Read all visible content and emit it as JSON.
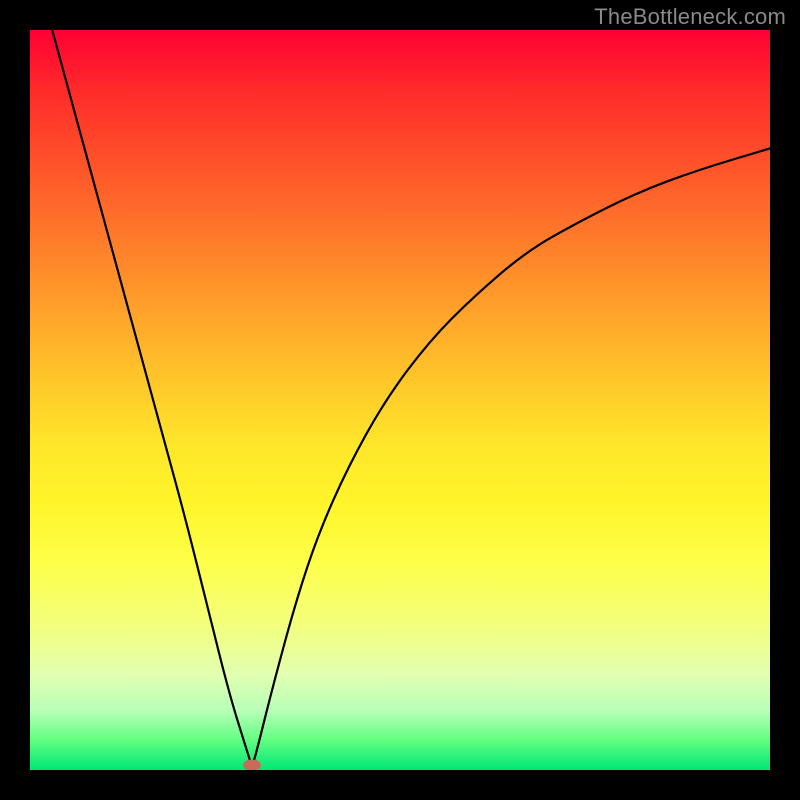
{
  "watermark": "TheBottleneck.com",
  "chart_data": {
    "type": "line",
    "title": "",
    "xlabel": "",
    "ylabel": "",
    "xlim": [
      0,
      1
    ],
    "ylim": [
      0,
      1
    ],
    "grid": false,
    "legend": false,
    "marker": {
      "x": 0.3,
      "y": 0.005,
      "color": "#c96b5a"
    },
    "series": [
      {
        "name": "bottleneck-curve",
        "descends_from_top_left_to_minimum_then_rises": true,
        "minimum_x": 0.3,
        "x": [
          0.03,
          0.06,
          0.09,
          0.12,
          0.15,
          0.18,
          0.21,
          0.24,
          0.27,
          0.295,
          0.3,
          0.305,
          0.33,
          0.36,
          0.39,
          0.43,
          0.48,
          0.54,
          0.6,
          0.67,
          0.74,
          0.82,
          0.9,
          1.0
        ],
        "y": [
          1.0,
          0.89,
          0.78,
          0.67,
          0.56,
          0.45,
          0.34,
          0.22,
          0.1,
          0.02,
          0.005,
          0.02,
          0.12,
          0.23,
          0.32,
          0.41,
          0.5,
          0.58,
          0.64,
          0.7,
          0.74,
          0.78,
          0.81,
          0.84
        ]
      }
    ],
    "background_gradient": {
      "orientation": "vertical-top-to-bottom",
      "colors": [
        "#ff0033",
        "#ffae2a",
        "#ffff40",
        "#00e676"
      ],
      "meaning": "red=high bottleneck, green=low"
    },
    "frame_color": "#000000"
  }
}
